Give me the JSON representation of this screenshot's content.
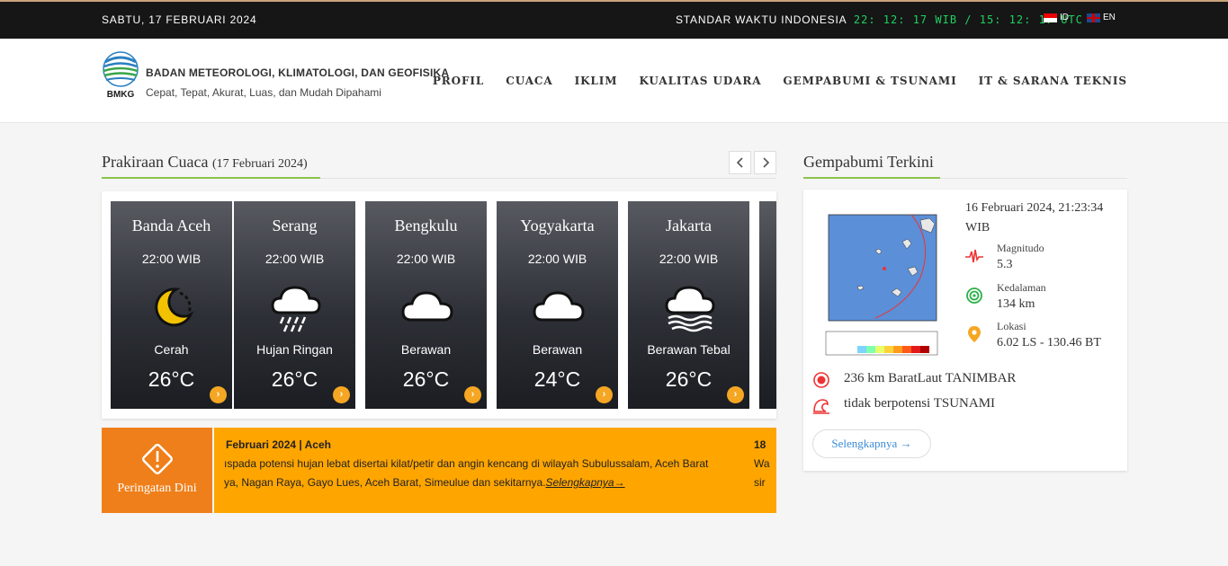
{
  "topbar": {
    "date": "SABTU, 17 FEBRUARI 2024",
    "time_label": "STANDAR WAKTU INDONESIA",
    "clock": "22: 12: 17 WIB / 15: 12: 17 UTC",
    "lang_id": "ID",
    "lang_en": "EN"
  },
  "header": {
    "logo_text": "BMKG",
    "org_name": "BADAN METEOROLOGI, KLIMATOLOGI, DAN GEOFISIKA",
    "tagline": "Cepat, Tepat, Akurat, Luas, dan Mudah Dipahami",
    "nav": [
      "PROFIL",
      "CUACA",
      "IKLIM",
      "KUALITAS UDARA",
      "GEMPABUMI & TSUNAMI",
      "IT & SARANA TEKNIS"
    ]
  },
  "forecast": {
    "title": "Prakiraan Cuaca",
    "date": "(17 Februari 2024)",
    "prev_icon": "chevron-left-icon",
    "next_icon": "chevron-right-icon",
    "cards": [
      {
        "city": "Banda Aceh",
        "time": "22:00 WIB",
        "icon": "moon-icon",
        "desc": "Cerah",
        "temp": "26°C"
      },
      {
        "city": "Serang",
        "time": "22:00 WIB",
        "icon": "rain-cloud-icon",
        "desc": "Hujan Ringan",
        "temp": "26°C"
      },
      {
        "city": "Bengkulu",
        "time": "22:00 WIB",
        "icon": "cloud-icon",
        "desc": "Berawan",
        "temp": "26°C"
      },
      {
        "city": "Yogyakarta",
        "time": "22:00 WIB",
        "icon": "cloud-icon",
        "desc": "Berawan",
        "temp": "24°C"
      },
      {
        "city": "Jakarta",
        "time": "22:00 WIB",
        "icon": "heavy-cloud-icon",
        "desc": "Berawan Tebal",
        "temp": "26°C"
      }
    ]
  },
  "warning": {
    "label": "Peringatan Dini",
    "heading": "Februari 2024 | Aceh",
    "line1": "ıspada potensi hujan lebat disertai kilat/petir dan angin kencang di wilayah Subulussalam, Aceh Barat",
    "line2": "ya, Nagan Raya, Gayo Lues, Aceh Barat, Simeulue dan sekitarnya.",
    "more": "Selengkapnya→",
    "next_heading": "18",
    "next_line1": "Wa",
    "next_line2": "sir"
  },
  "earthquake": {
    "title": "Gempabumi Terkini",
    "datetime": "16 Februari 2024, 21:23:34 WIB",
    "magnitude_label": "Magnitudo",
    "magnitude": "5.3",
    "depth_label": "Kedalaman",
    "depth": "134 km",
    "location_label": "Lokasi",
    "location": "6.02 LS - 130.46 BT",
    "distance": "236 km BaratLaut TANIMBAR",
    "tsunami": "tidak berpotensi TSUNAMI",
    "more": "Selengkapnya →"
  },
  "colors": {
    "topbar_bg": "#161616",
    "clock_green": "#20d160",
    "accent_green": "#8bc34a",
    "warning_orange": "#ef7f1a",
    "warning_yellow": "#ffa500",
    "link_blue": "#3b8bd4"
  }
}
